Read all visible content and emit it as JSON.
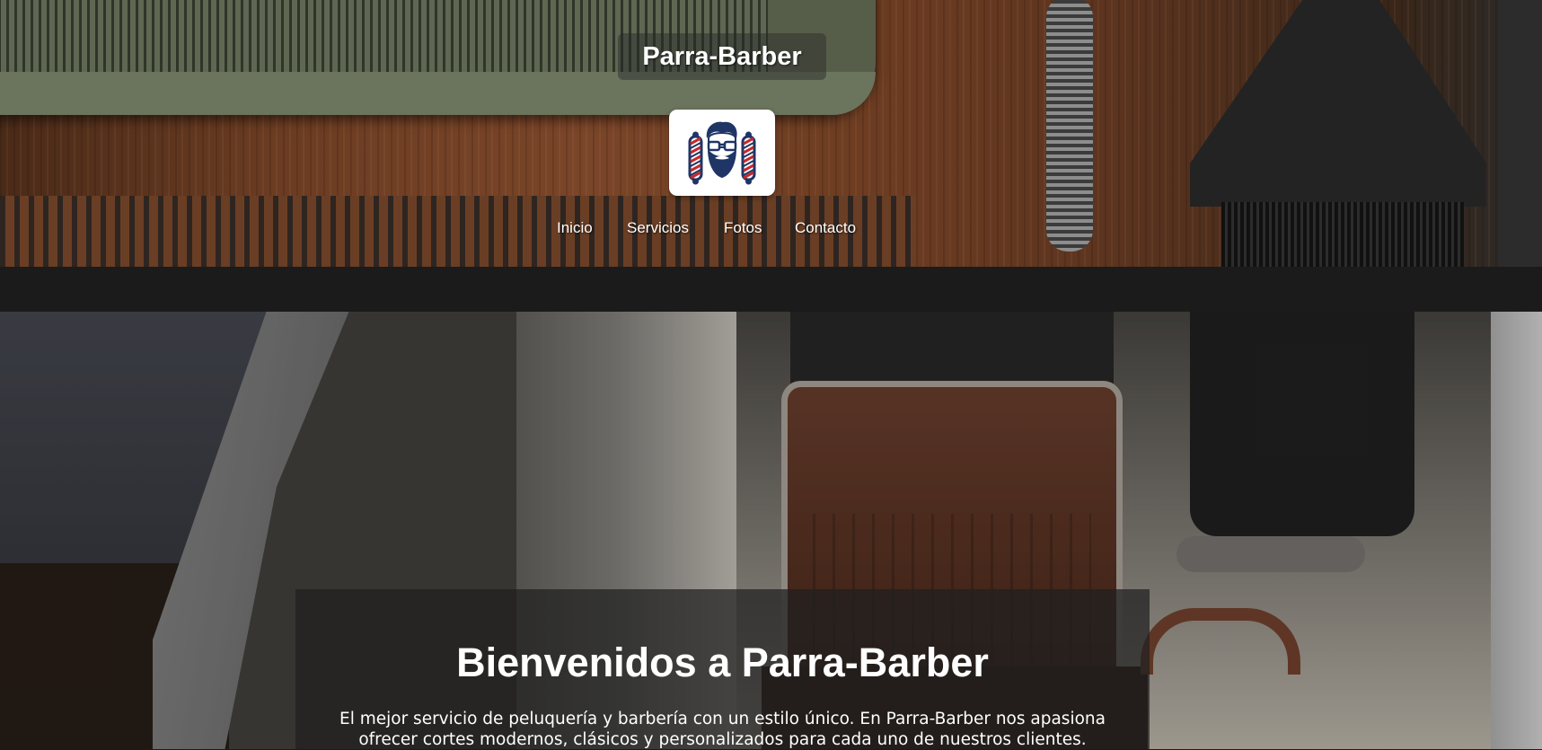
{
  "header": {
    "site_title": "Parra-Barber",
    "logo_icon": "bearded-man-barber-poles-icon"
  },
  "nav": {
    "items": [
      {
        "label": "Inicio"
      },
      {
        "label": "Servicios"
      },
      {
        "label": "Fotos"
      },
      {
        "label": "Contacto"
      }
    ]
  },
  "hero": {
    "title": "Bienvenidos a Parra-Barber",
    "text": "El mejor servicio de peluquería y barbería con un estilo único. En Parra-Barber nos apasiona ofrecer cortes modernos, clásicos y personalizados para cada uno de nuestros clientes."
  },
  "colors": {
    "background": "#1b1b1b",
    "text": "#ffffff",
    "logo_navy": "#1f3566",
    "logo_red": "#c62828"
  }
}
